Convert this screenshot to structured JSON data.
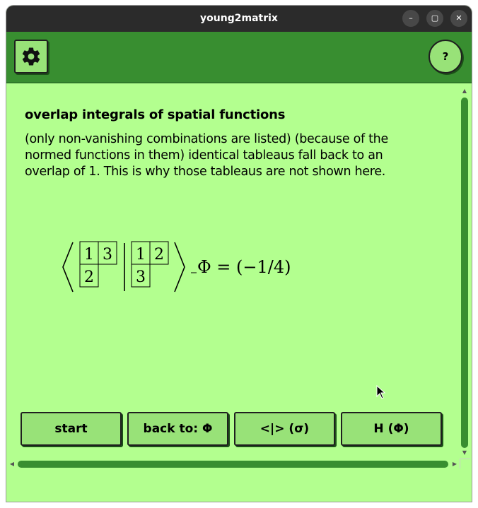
{
  "window": {
    "title": "young2matrix"
  },
  "toolbar": {
    "settings_icon": "gear-icon",
    "help_label": "?"
  },
  "content": {
    "heading": "overlap integrals of spatial functions",
    "description": "(only non-vanishing combinations are listed) (because of the normed functions in them) identical tableaus fall back to an overlap of 1. This is why those tableaus are not shown here.",
    "formula": {
      "bra": {
        "row1": [
          "1",
          "3"
        ],
        "row2": [
          "2"
        ]
      },
      "ket": {
        "row1": [
          "1",
          "2"
        ],
        "row2": [
          "3"
        ]
      },
      "result": "Φ = (−1/4)"
    }
  },
  "buttons": {
    "start": "start",
    "back": "back to: Φ",
    "braket": "<|> (σ)",
    "hamiltonian": "H (Φ)"
  }
}
